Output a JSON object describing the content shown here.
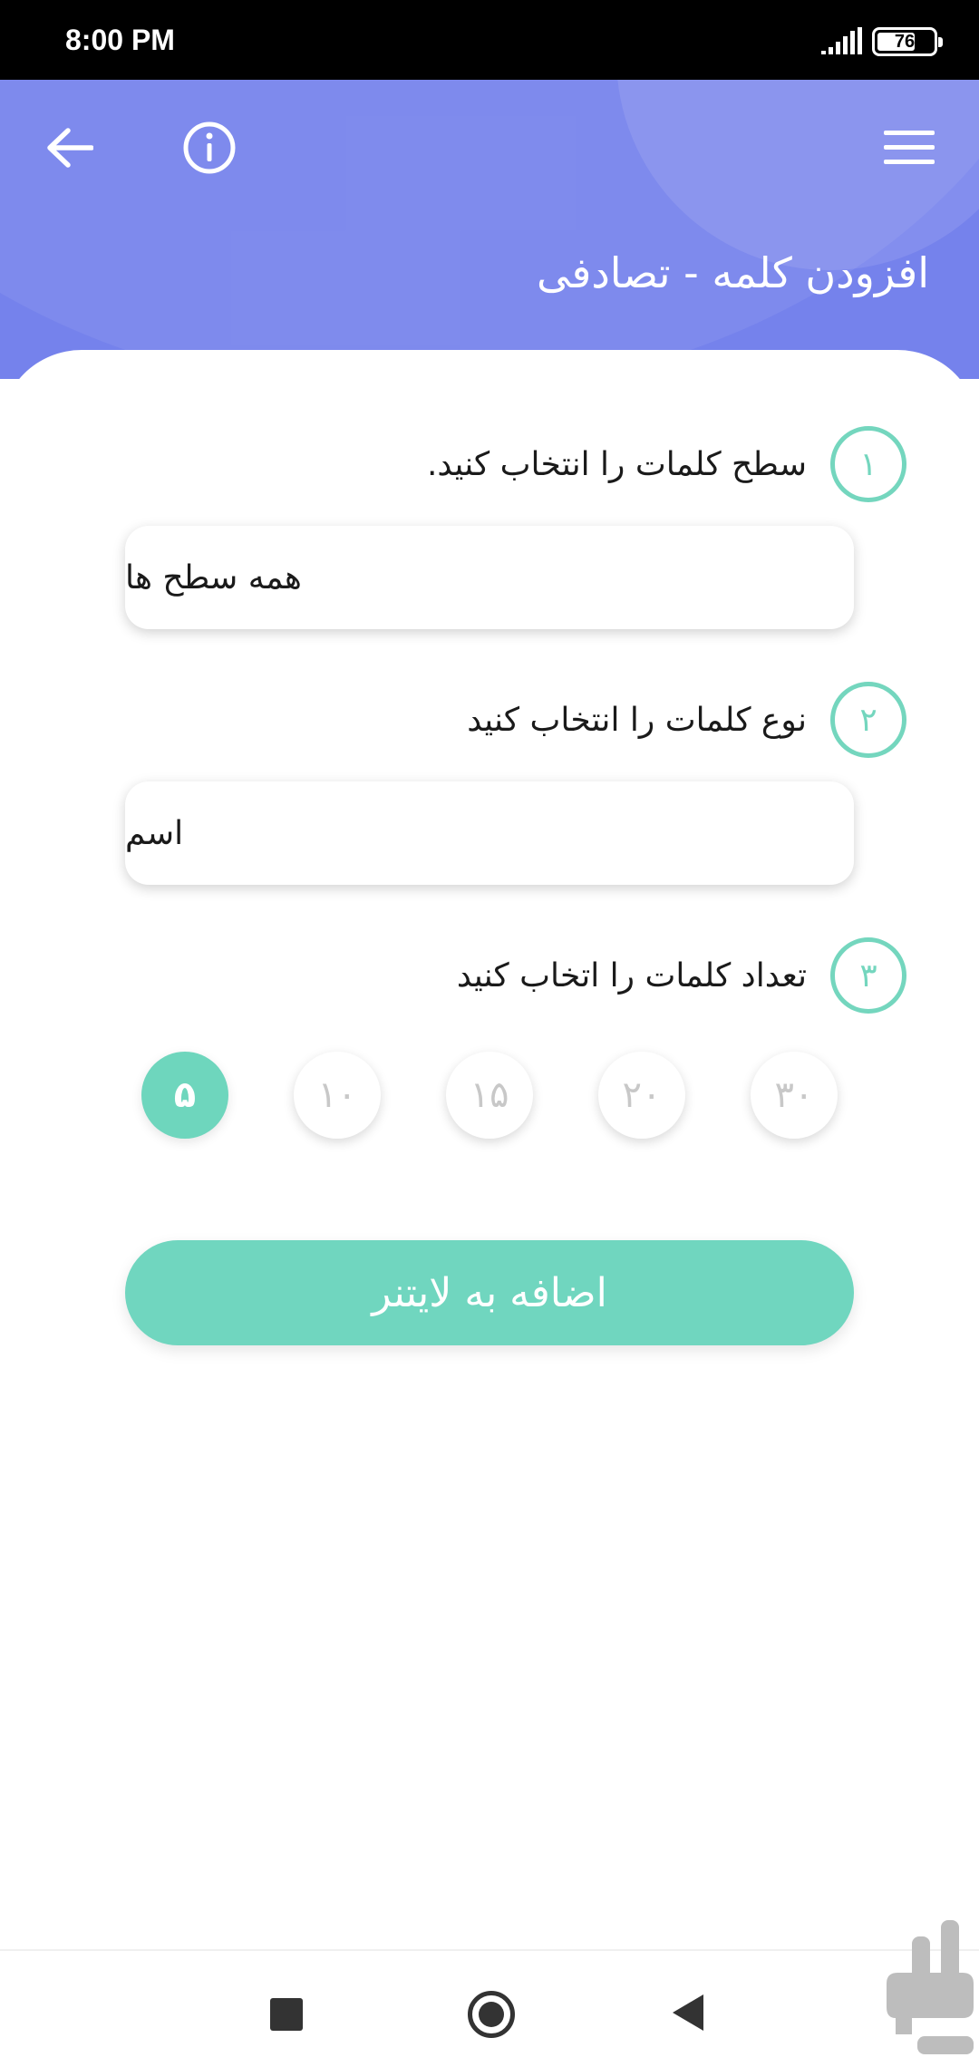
{
  "status_bar": {
    "time": "8:00 PM",
    "battery": "76"
  },
  "header": {
    "title": "افزودن کلمه - تصادفی"
  },
  "steps": [
    {
      "number": "۱",
      "label": "سطح کلمات را انتخاب کنید.",
      "selected_value": "همه سطح ها"
    },
    {
      "number": "۲",
      "label": "نوع کلمات را انتخاب کنید",
      "selected_value": "اسم"
    },
    {
      "number": "۳",
      "label": "تعداد کلمات را اتخاب کنید"
    }
  ],
  "word_counts": {
    "options": [
      "۵",
      "۱۰",
      "۱۵",
      "۲۰",
      "۳۰"
    ],
    "selected": "۵"
  },
  "add_button": {
    "label": "اضافه به لایتنر"
  },
  "colors": {
    "header": "#7582ec",
    "accent": "#70d6bf"
  },
  "icons": [
    "back-arrow-icon",
    "info-icon",
    "hamburger-menu-icon",
    "signal-icon",
    "battery-icon"
  ]
}
